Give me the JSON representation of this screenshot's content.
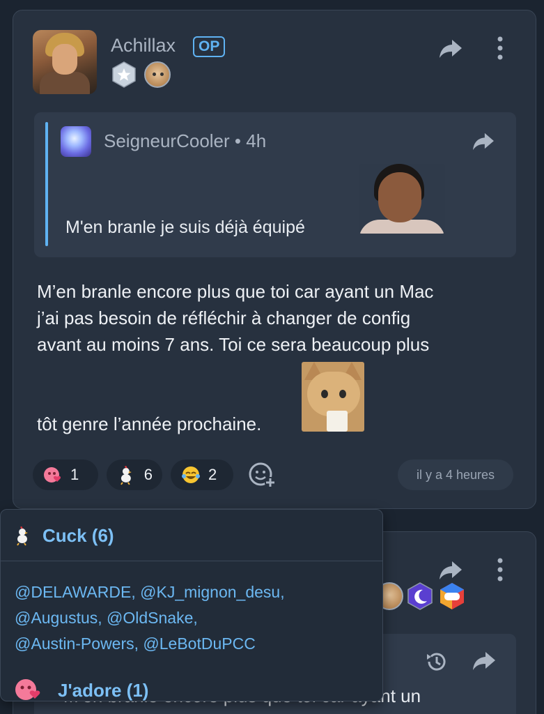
{
  "post": {
    "author": "Achillax",
    "op_label": "OP",
    "quote": {
      "author": "SeigneurCooler",
      "separator": "•",
      "age": "4h",
      "text": "M'en branle je suis déjà équipé"
    },
    "body_lines": [
      "M’en branle encore plus que toi car ayant un Mac",
      "j’ai pas besoin de réfléchir à changer de config",
      "avant au moins 7 ans. Toi ce sera beaucoup plus"
    ],
    "body_last_line": "tôt genre l’année prochaine.",
    "reactions": [
      {
        "emoji": "jadore",
        "count": "1"
      },
      {
        "emoji": "cuck-rooster",
        "count": "6"
      },
      {
        "emoji": "laughing-tears",
        "count": "2"
      }
    ],
    "timestamp": "il y a 4 heures"
  },
  "second_post": {
    "quote_text": "M’en branle encore plus que toi car ayant un"
  },
  "popover": {
    "title": "Cuck (6)",
    "users": [
      "@DELAWARDE,",
      "@KJ_mignon_desu,",
      "@Augustus,",
      "@OldSnake,",
      "@Austin-Powers,",
      "@LeBotDuPCC"
    ],
    "next_title": "J'adore (1)"
  },
  "colors": {
    "accent": "#5fb2f2",
    "background": "#1b2430",
    "card": "#27313f"
  }
}
